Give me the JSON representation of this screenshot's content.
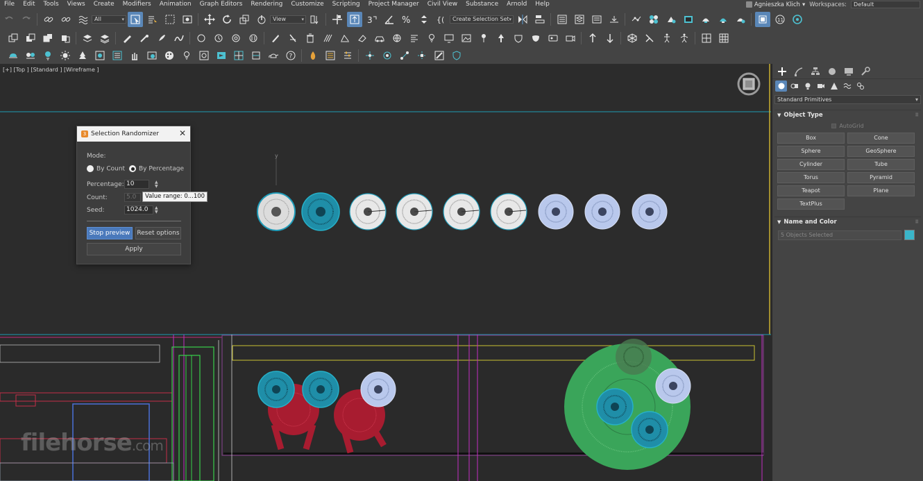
{
  "menubar": {
    "items": [
      "File",
      "Edit",
      "Tools",
      "Views",
      "Create",
      "Modifiers",
      "Animation",
      "Graph Editors",
      "Rendering",
      "Customize",
      "Scripting",
      "Project Manager",
      "Civil View",
      "Substance",
      "Arnold",
      "Help"
    ],
    "user_name": "Agnieszka Klich",
    "workspaces_label": "Workspaces:",
    "workspace_value": "Default"
  },
  "toolbar": {
    "selection_filter": "All",
    "ref_coord": "View",
    "named_selection": "Create Selection Set"
  },
  "viewport": {
    "label": "[+] [Top ] [Standard ] [Wireframe ]",
    "axis_label": "y",
    "watermark_main": "filehorse",
    "watermark_suffix": ".com"
  },
  "dialog": {
    "title": "Selection Randomizer",
    "close_glyph": "✕",
    "mode_label": "Mode:",
    "mode_options": [
      "By Count",
      "By Percentage"
    ],
    "selected_mode": "By Percentage",
    "percentage_label": "Percentage:",
    "percentage_value": "10",
    "count_label": "Count:",
    "count_value": "5.0",
    "seed_label": "Seed:",
    "seed_value": "1024.0",
    "stop_preview_label": "Stop preview",
    "reset_options_label": "Reset options",
    "apply_label": "Apply",
    "tooltip": "Value range: 0...100"
  },
  "command_panel": {
    "category": "Standard Primitives",
    "object_type_header": "Object Type",
    "autogrid_label": "AutoGrid",
    "primitives": [
      "Box",
      "Cone",
      "Sphere",
      "GeoSphere",
      "Cylinder",
      "Tube",
      "Torus",
      "Pyramid",
      "Teapot",
      "Plane",
      "TextPlus"
    ],
    "name_color_header": "Name and Color",
    "name_value": "5 Objects Selected",
    "object_color": "#3ab5c9"
  },
  "colors": {
    "selection_cyan": "#1f9bb8",
    "white_wire": "#e8e8e8",
    "lavender_wire": "#b9c8ec",
    "red_wire": "#c42035",
    "green_wire": "#3aa55a",
    "magenta_line": "#c22ec2",
    "accent_blue": "#5a87b8"
  }
}
